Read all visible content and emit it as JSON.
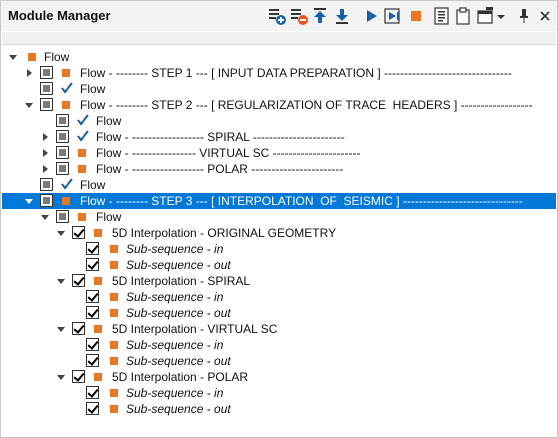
{
  "window": {
    "title": "Module Manager"
  },
  "toolbar": {
    "icons": [
      "add-module-icon",
      "remove-module-icon",
      "move-up-icon",
      "move-down-icon",
      "run-icon",
      "run-to-icon",
      "stop-icon",
      "list-icon",
      "clipboard-icon",
      "window-menu-icon",
      "dropdown-icon",
      "pin-icon",
      "close-icon"
    ]
  },
  "colors": {
    "accent_orange": "#e87722",
    "selection_blue": "#0078d7",
    "check_blue": "#1a5ea8"
  },
  "tree": {
    "rows": [
      {
        "label": "Flow"
      },
      {
        "label": "Flow - -------- STEP 1 --- [ INPUT DATA PREPARATION ] --------------------------------"
      },
      {
        "label": "Flow"
      },
      {
        "label": "Flow - -------- STEP 2 --- [ REGULARIZATION OF TRACE  HEADERS ] ------------------"
      },
      {
        "label": "Flow"
      },
      {
        "label": "Flow - ------------------ SPIRAL -----------------------"
      },
      {
        "label": "Flow - ---------------- VIRTUAL SC ----------------------"
      },
      {
        "label": "Flow - ------------------ POLAR -----------------------"
      },
      {
        "label": "Flow"
      },
      {
        "label": "Flow - -------- STEP 3 --- [ INTERPOLATION  OF  SEISMIC ] ------------------------------"
      },
      {
        "label": "Flow"
      },
      {
        "label": "5D Interpolation - ORIGINAL GEOMETRY"
      },
      {
        "label": "Sub-sequence - in"
      },
      {
        "label": "Sub-sequence - out"
      },
      {
        "label": "5D Interpolation - SPIRAL"
      },
      {
        "label": "Sub-sequence - in"
      },
      {
        "label": "Sub-sequence - out"
      },
      {
        "label": "5D Interpolation - VIRTUAL SC"
      },
      {
        "label": "Sub-sequence - in"
      },
      {
        "label": "Sub-sequence - out"
      },
      {
        "label": "5D Interpolation - POLAR"
      },
      {
        "label": "Sub-sequence - in"
      },
      {
        "label": "Sub-sequence - out"
      }
    ]
  }
}
